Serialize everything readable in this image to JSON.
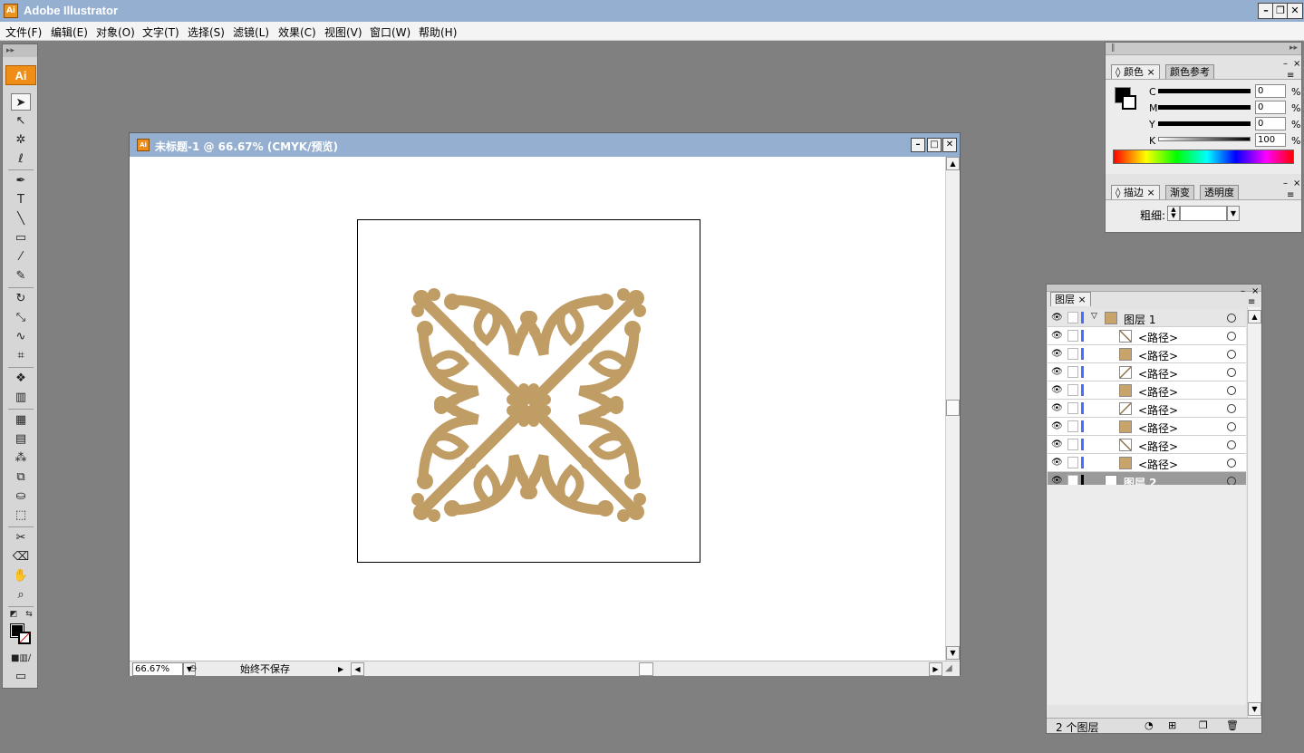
{
  "app": {
    "title": "Adobe Illustrator",
    "icon": "Ai"
  },
  "menubar": {
    "items": [
      "文件(F)",
      "编辑(E)",
      "对象(O)",
      "文字(T)",
      "选择(S)",
      "滤镜(L)",
      "效果(C)",
      "视图(V)",
      "窗口(W)",
      "帮助(H)"
    ]
  },
  "toolbox": {
    "logo": "Ai",
    "tools": [
      "selection-tool",
      "direct-selection-tool",
      "magic-wand-tool",
      "lasso-tool",
      "pen-tool",
      "type-tool",
      "line-tool",
      "rectangle-tool",
      "paintbrush-tool",
      "pencil-tool",
      "rotate-tool",
      "scale-tool",
      "warp-tool",
      "free-transform-tool",
      "symbol-sprayer-tool",
      "graph-tool",
      "mesh-tool",
      "gradient-tool",
      "eyedropper-tool",
      "blend-tool",
      "live-paint-bucket-tool",
      "live-paint-selection-tool",
      "slice-tool",
      "eraser-tool",
      "hand-tool",
      "zoom-tool"
    ]
  },
  "document": {
    "title": "未标题-1 @ 66.67% (CMYK/预览)",
    "zoom": "66.67%",
    "status": "始终不保存",
    "artwork_color": "#c19d66"
  },
  "color_panel": {
    "tabs": [
      "颜色",
      "颜色参考"
    ],
    "channels": [
      {
        "label": "C",
        "value": "0"
      },
      {
        "label": "M",
        "value": "0"
      },
      {
        "label": "Y",
        "value": "0"
      },
      {
        "label": "K",
        "value": "100"
      }
    ],
    "percent": "%",
    "fill_color": "#000000"
  },
  "stroke_panel": {
    "tabs": [
      "描边",
      "渐变",
      "透明度"
    ],
    "weight_label": "粗细:",
    "weight_value": ""
  },
  "layers_panel": {
    "tab": "图层",
    "layers": [
      {
        "name": "图层 1",
        "kind": "layer",
        "thumb": "ornament"
      },
      {
        "name": "<路径>",
        "kind": "path",
        "thumb": "line"
      },
      {
        "name": "<路径>",
        "kind": "path",
        "thumb": "ornament"
      },
      {
        "name": "<路径>",
        "kind": "path",
        "thumb": "line-reverse"
      },
      {
        "name": "<路径>",
        "kind": "path",
        "thumb": "ornament"
      },
      {
        "name": "<路径>",
        "kind": "path",
        "thumb": "line-reverse"
      },
      {
        "name": "<路径>",
        "kind": "path",
        "thumb": "ornament"
      },
      {
        "name": "<路径>",
        "kind": "path",
        "thumb": "line"
      },
      {
        "name": "<路径>",
        "kind": "path",
        "thumb": "ornament"
      },
      {
        "name": "图层 2",
        "kind": "layer",
        "thumb": "blank"
      }
    ],
    "footer_count": "2 个图层"
  }
}
